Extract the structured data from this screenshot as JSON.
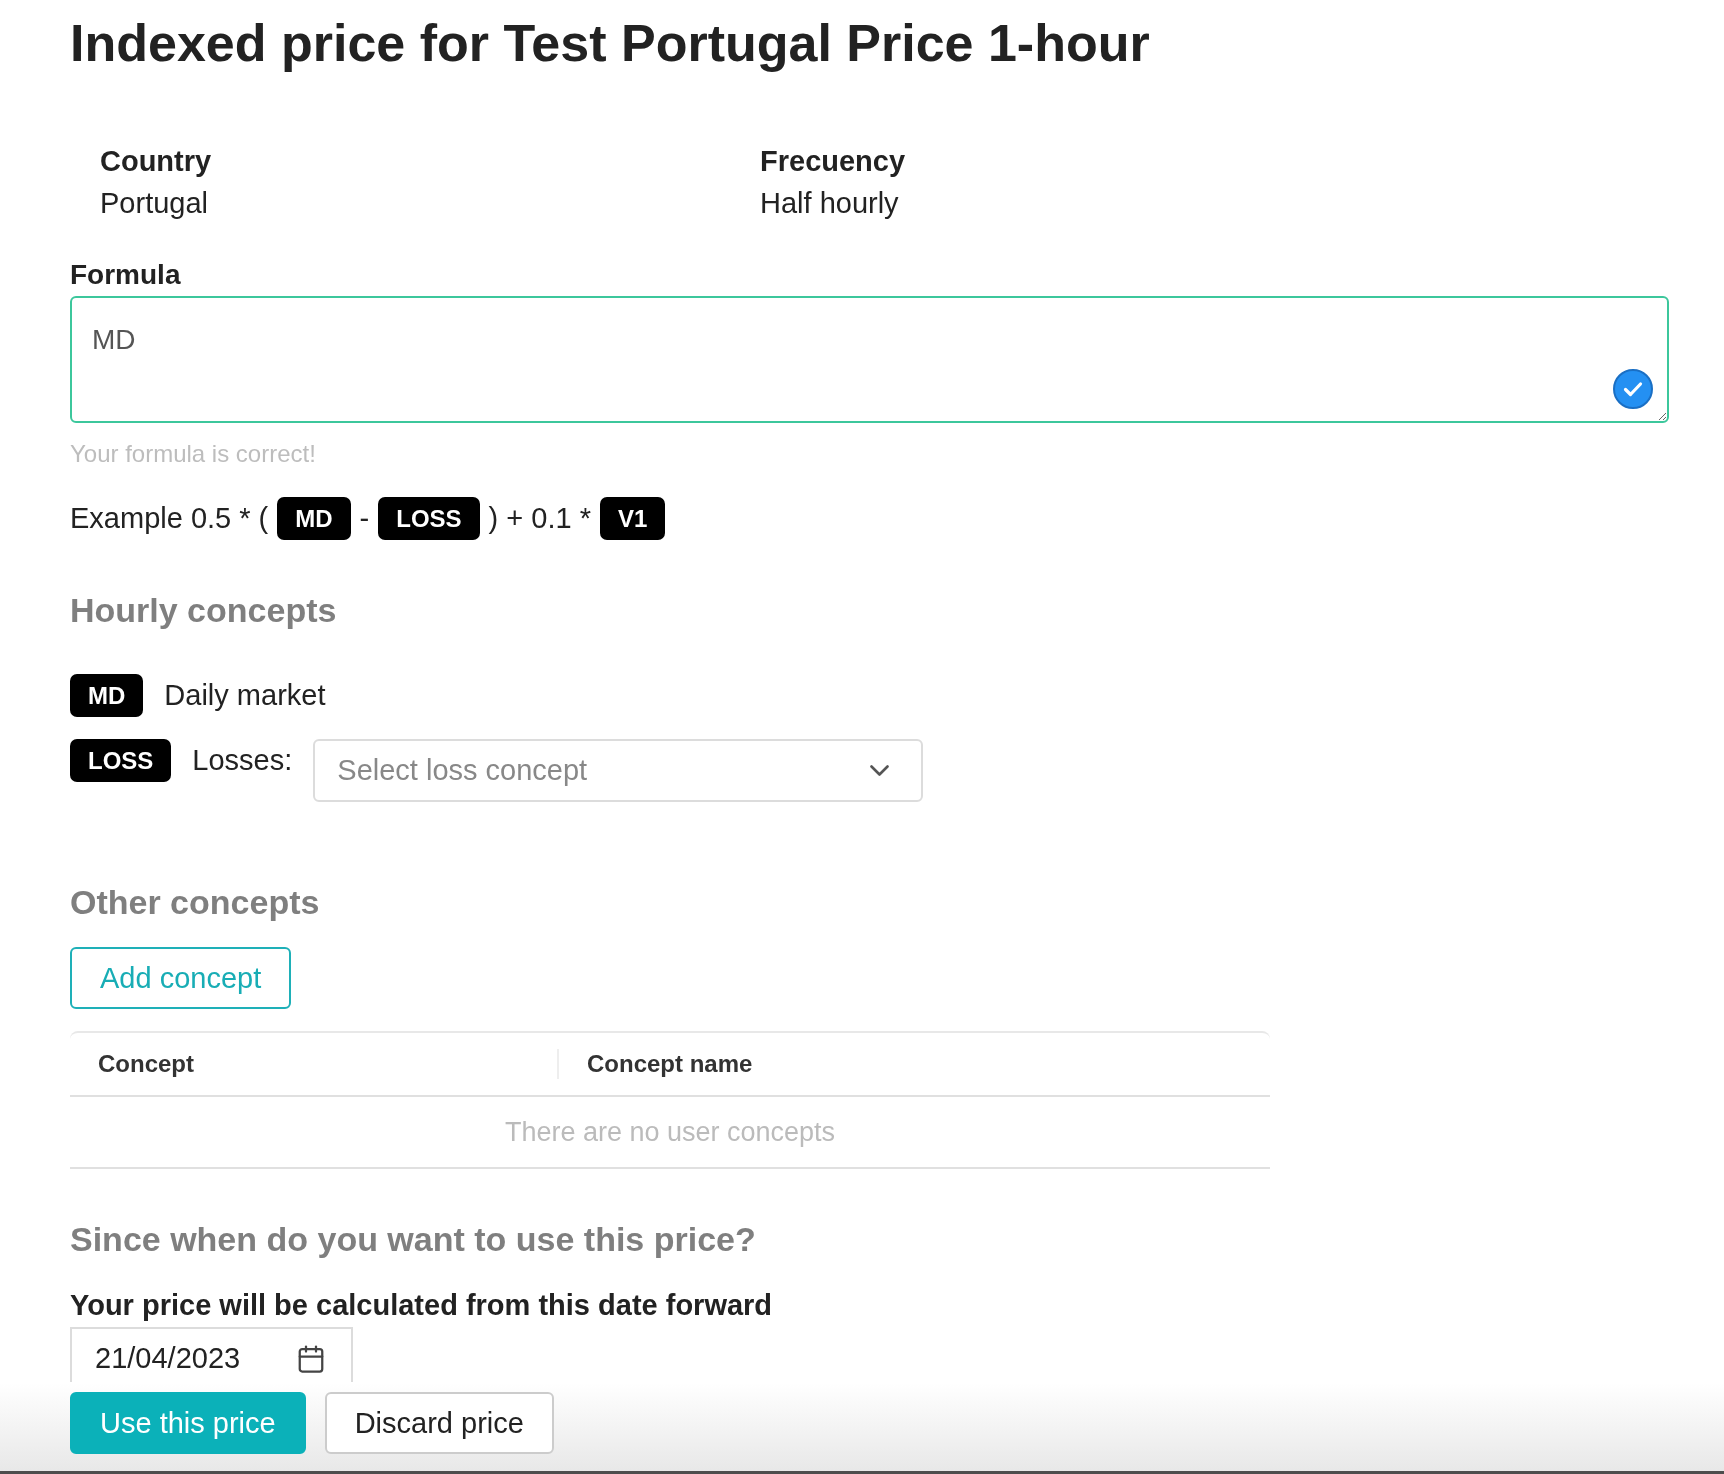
{
  "title": "Indexed price for Test Portugal Price 1-hour",
  "details": [
    {
      "label": "Country",
      "value": "Portugal"
    },
    {
      "label": "Frecuency",
      "value": "Half hourly"
    }
  ],
  "formula": {
    "label": "Formula",
    "value": "MD",
    "valid": true,
    "message": "Your formula is correct!"
  },
  "example": [
    {
      "kind": "text",
      "text": "Example 0.5 * ("
    },
    {
      "kind": "tag",
      "text": "MD"
    },
    {
      "kind": "text",
      "text": "-"
    },
    {
      "kind": "tag",
      "text": "LOSS"
    },
    {
      "kind": "text",
      "text": ") + 0.1 *"
    },
    {
      "kind": "tag",
      "text": "V1"
    }
  ],
  "hourly_concepts": {
    "heading": "Hourly concepts",
    "items": [
      {
        "kind": "description",
        "tag": "MD",
        "text": "Daily market"
      },
      {
        "kind": "select",
        "tag": "LOSS",
        "label": "Losses:",
        "placeholder": "Select loss concept"
      }
    ]
  },
  "other_concepts": {
    "heading": "Other concepts",
    "add_button": "Add concept",
    "table": {
      "columns": [
        "Concept",
        "Concept name"
      ],
      "empty_message": "There are no user concepts"
    }
  },
  "start_date": {
    "heading": "Since when do you want to use this price?",
    "label": "Your price will be calculated from this date forward",
    "value": "21/04/2023"
  },
  "actions": [
    {
      "kind": "primary",
      "label": "Use this price"
    },
    {
      "kind": "secondary",
      "label": "Discard price"
    }
  ]
}
